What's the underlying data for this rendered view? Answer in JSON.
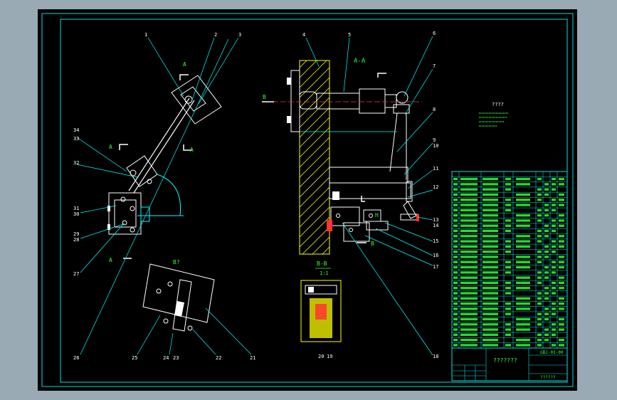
{
  "colors": {
    "background": "#99aab5",
    "canvas": "#000000",
    "frame": "#00e0e0",
    "part": "#ffffff",
    "dimension": "#00ffff",
    "centerline": "#ff3333",
    "wall": "#ffff00",
    "text": "#33ff33"
  },
  "views": {
    "section_aa": "A-A",
    "section_bb": "B-B",
    "section_bb_scale": "1:1",
    "view_b": "B?",
    "arrow_a": "A",
    "arrow_b": "B",
    "arrow_h": "H"
  },
  "callouts_left": [
    "1",
    "2",
    "3",
    "34",
    "33",
    "32",
    "31",
    "30",
    "29",
    "28",
    "27",
    "26",
    "25",
    "24",
    "23",
    "22",
    "21"
  ],
  "callouts_right": [
    "4",
    "5",
    "6",
    "7",
    "8",
    "9",
    "10",
    "11",
    "12",
    "13",
    "14",
    "15",
    "16",
    "17",
    "18",
    "19",
    "20"
  ],
  "notes": {
    "title": "????"
  },
  "title_block": {
    "drawing_no": "GBJ-03-00",
    "title": "???????",
    "school": "??????"
  }
}
